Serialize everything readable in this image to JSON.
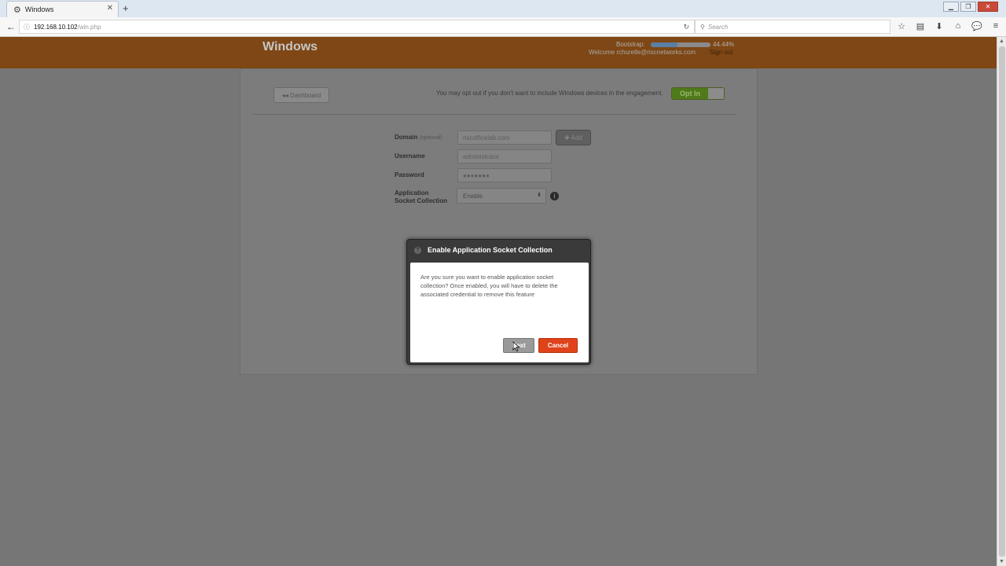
{
  "browser": {
    "tab_title": "Windows",
    "url_host": "192.168.10.102",
    "url_path": "/win.php",
    "search_placeholder": "Search"
  },
  "header": {
    "title": "Windows",
    "bootstrap_label": "Bootstrap:",
    "bootstrap_progress": 0.4444,
    "bootstrap_percent": "44.44%",
    "welcome_text": "Welcome rchurelle@riscnetworks.com",
    "signout_label": "Sign out",
    "accent_color": "#7e4715"
  },
  "toolbar": {
    "dashboard_label": "◂◂ Dashboard",
    "optin_message": "You may opt out if you don't want to include Windows devices in the engagement.",
    "optin_label": "Opt In"
  },
  "form": {
    "domain_label": "Domain",
    "domain_optional": "(optional)",
    "domain_value": "riscofficelab.com",
    "add_label": "✚ Add",
    "username_label": "Username",
    "username_value": "administrator",
    "password_label": "Password",
    "password_value": "●●●●●●●",
    "app_socket_label_line1": "Application",
    "app_socket_label_line2": "Socket Collection",
    "app_socket_value": "Enable"
  },
  "modal": {
    "title": "Enable Application Socket Collection",
    "message": "Are you sure you want to enable application socket collection? Once enabled, you will have to delete the associated credential to remove this feature",
    "next_label": "Next",
    "cancel_label": "Cancel",
    "cancel_color": "#e0421a"
  }
}
